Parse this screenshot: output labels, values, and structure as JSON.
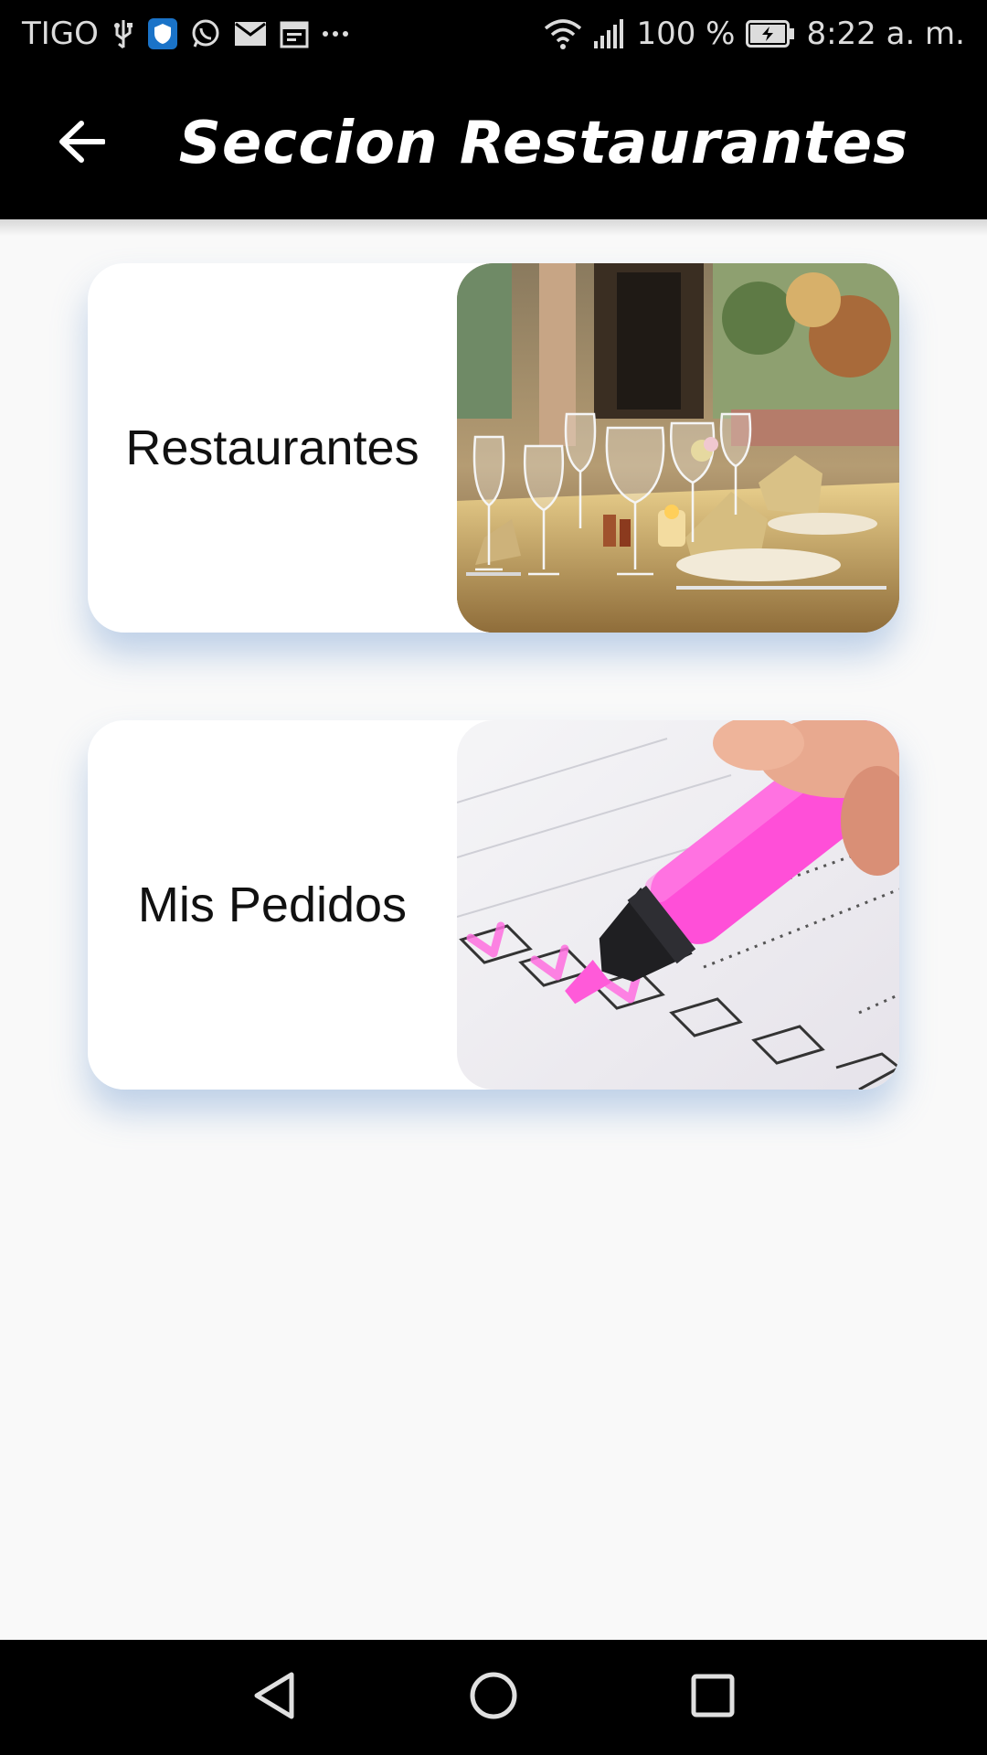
{
  "status_bar": {
    "carrier": "TIGO",
    "battery": "100 %",
    "time": "8:22 a. m.",
    "icons": [
      "usb-icon",
      "shield-app-icon",
      "whatsapp-icon",
      "mail-icon",
      "calendar-icon",
      "more-dots-icon",
      "wifi-icon",
      "signal-icon",
      "battery-charging-icon"
    ]
  },
  "app_bar": {
    "back_icon": "arrow-back-icon",
    "title": "Seccion Restaurantes"
  },
  "cards": [
    {
      "label": "Restaurantes",
      "image": "restaurant-table-photo"
    },
    {
      "label": "Mis Pedidos",
      "image": "checklist-highlighter-photo"
    }
  ],
  "nav_bar": {
    "icons": [
      "nav-back-triangle-icon",
      "nav-home-circle-icon",
      "nav-recents-square-icon"
    ]
  },
  "colors": {
    "app_bar_bg": "#000000",
    "content_bg": "#f9f9f9",
    "card_shadow": "#78a0d2",
    "highlighter": "#ff4fd8"
  }
}
